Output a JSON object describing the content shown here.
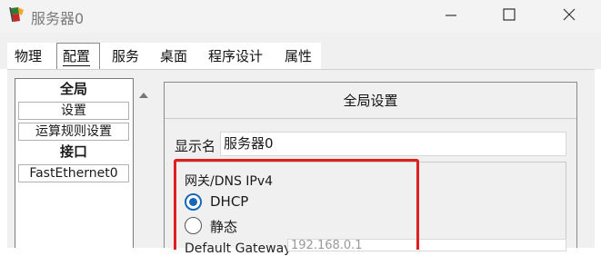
{
  "window": {
    "title": "服务器0",
    "controls": [
      "minimize-icon",
      "maximize-icon",
      "close-icon"
    ]
  },
  "tabs": [
    {
      "label": "物理",
      "active": false
    },
    {
      "label": "配置",
      "active": true
    },
    {
      "label": "服务",
      "active": false
    },
    {
      "label": "桌面",
      "active": false
    },
    {
      "label": "程序设计",
      "active": false
    },
    {
      "label": "属性",
      "active": false
    }
  ],
  "left_nav": {
    "items": [
      {
        "label": "全局",
        "kind": "header"
      },
      {
        "label": "设置",
        "kind": "button"
      },
      {
        "label": "运算规则设置",
        "kind": "button"
      },
      {
        "label": "接口",
        "kind": "header"
      },
      {
        "label": "FastEthernet0",
        "kind": "button"
      }
    ]
  },
  "panel": {
    "title": "全局设置",
    "display_name_label": "显示名",
    "display_name_value": "服务器0",
    "gateway_group": {
      "label": "网关/DNS IPv4",
      "options": [
        {
          "label": "DHCP",
          "checked": true
        },
        {
          "label": "静态",
          "checked": false
        }
      ]
    },
    "cut_off_row": {
      "label": "Default Gateway",
      "value": "192.168.0.1"
    }
  },
  "colors": {
    "accent": "#1a66b8",
    "highlight": "#e02020"
  }
}
